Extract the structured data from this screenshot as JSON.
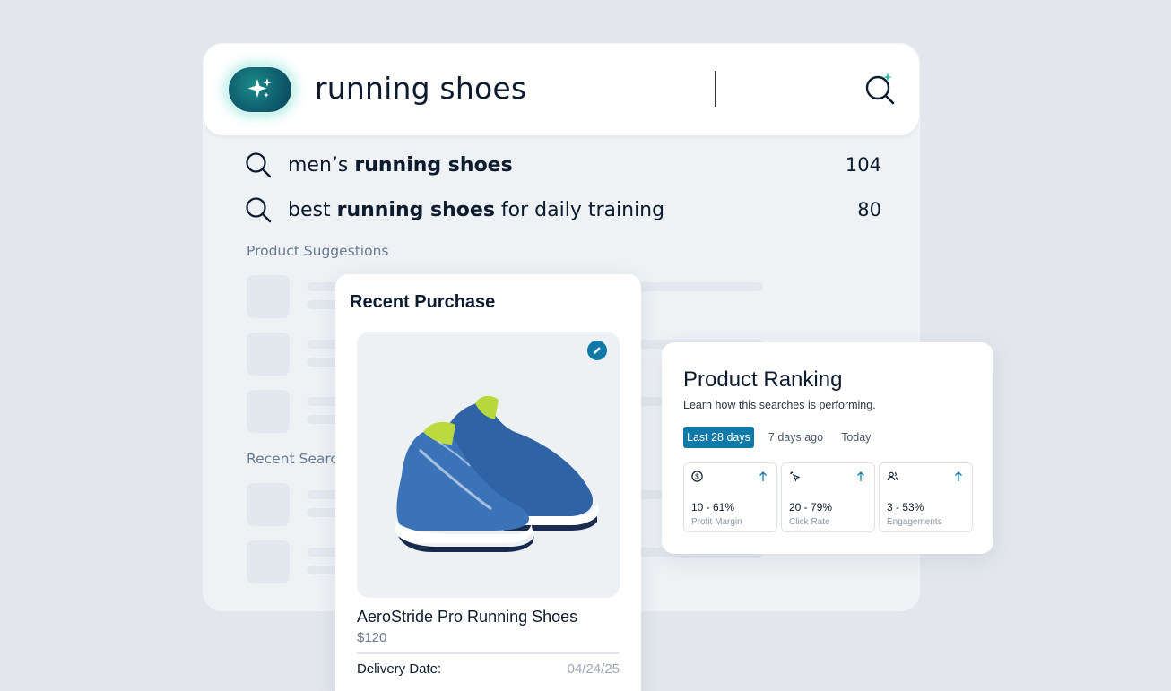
{
  "search": {
    "query": "running shoes",
    "ai_icon": "sparkles-icon",
    "search_icon": "search-sparkle-icon"
  },
  "suggestions": [
    {
      "prefix": "men’s ",
      "bold": "running shoes",
      "suffix": "",
      "count": "104"
    },
    {
      "prefix": "best ",
      "bold": "running shoes",
      "suffix": " for daily training",
      "count": "80"
    }
  ],
  "sections": {
    "product_suggestions": "Product Suggestions",
    "recent_searches": "Recent Searches"
  },
  "purchase": {
    "title": "Recent Purchase",
    "product_name": "AeroStride Pro Running Shoes",
    "price": "$120",
    "delivery_label": "Delivery Date:",
    "delivery_date": "04/24/25",
    "edit_icon": "pencil-icon"
  },
  "ranking": {
    "title": "Product Ranking",
    "subtitle": "Learn how this searches is performing.",
    "tabs": [
      "Last 28 days",
      "7 days ago",
      "Today"
    ],
    "active_tab": "Last 28 days",
    "metrics": [
      {
        "icon": "dollar-icon",
        "value": "10 - 61%",
        "label": "Profit Margin"
      },
      {
        "icon": "click-icon",
        "value": "20 - 79%",
        "label": "Click Rate"
      },
      {
        "icon": "users-icon",
        "value": "3 - 53%",
        "label": "Engagements"
      }
    ]
  },
  "colors": {
    "accent": "#0f7aa8",
    "ai_teal": "#0f5f6f",
    "background": "#e3e7ed"
  }
}
